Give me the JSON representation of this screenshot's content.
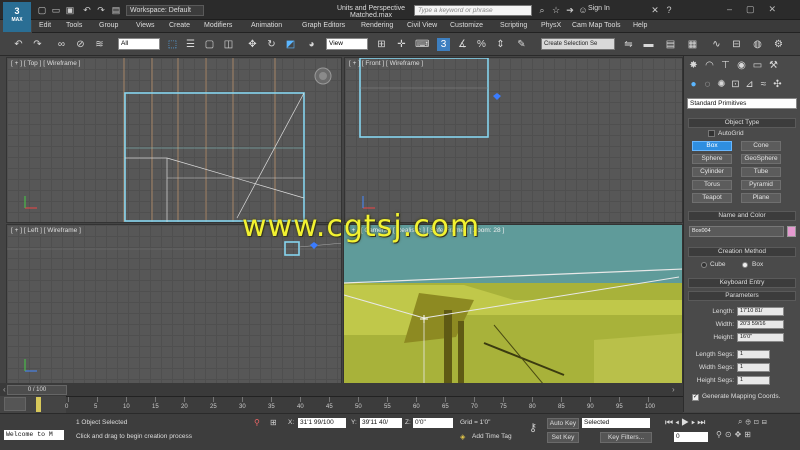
{
  "app": {
    "logo_text": "3",
    "logo_sub": "MAX",
    "workspace": "Workspace: Default",
    "document_title": "Units and Perspective Matched.max",
    "search_placeholder": "Type a keyword or phrase",
    "sign_in": "Sign In"
  },
  "menu": [
    "Edit",
    "Tools",
    "Group",
    "Views",
    "Create",
    "Modifiers",
    "Animation",
    "Graph Editors",
    "Rendering",
    "Civil View",
    "Customize",
    "Scripting",
    "PhysX",
    "Cam Map Tools",
    "Help"
  ],
  "toolbar": {
    "selection_filter": "All",
    "reference_coord": "View",
    "snap_label": "3",
    "selection_set": "Create Selection Se"
  },
  "viewports": {
    "top": "[ + ] [ Top ] [ Wireframe ]",
    "front": "[ + ] [ Front ] [ Wireframe ]",
    "left": "[ + ] [ Left ] [ Wireframe ]",
    "camera": "[ + ] [ Camera ] [ Realistic ] [ Safe Frame ] [ Zoom: 28 ]"
  },
  "watermark": "www.cgtsj.com",
  "command_panel": {
    "category": "Standard Primitives",
    "object_type_title": "Object Type",
    "autogrid": "AutoGrid",
    "buttons": [
      "Box",
      "Cone",
      "Sphere",
      "GeoSphere",
      "Cylinder",
      "Tube",
      "Torus",
      "Pyramid",
      "Teapot",
      "Plane"
    ],
    "selected_button": "Box",
    "name_color_title": "Name and Color",
    "object_name": "Box004",
    "object_color": "#e59ad0",
    "creation_method_title": "Creation Method",
    "creation_cube": "Cube",
    "creation_box": "Box",
    "keyboard_entry_title": "Keyboard Entry",
    "parameters_title": "Parameters",
    "length_label": "Length:",
    "length_value": "17'10 81/",
    "width_label": "Width:",
    "width_value": "20'3 59/16",
    "height_label": "Height:",
    "height_value": "16'0\"",
    "length_segs_label": "Length Segs:",
    "length_segs": "1",
    "width_segs_label": "Width Segs:",
    "width_segs": "1",
    "height_segs_label": "Height Segs:",
    "height_segs": "1",
    "gen_mapping": "Generate Mapping Coords."
  },
  "timeline": {
    "slider": "0 / 100",
    "ticks": [
      "0",
      "5",
      "10",
      "15",
      "20",
      "25",
      "30",
      "35",
      "40",
      "45",
      "50",
      "55",
      "60",
      "65",
      "70",
      "75",
      "80",
      "85",
      "90",
      "95",
      "100"
    ]
  },
  "status": {
    "maxscript": "Welcome to M",
    "selected": "1 Object Selected",
    "prompt": "Click and drag to begin creation process",
    "x_label": "X:",
    "x_value": "31'1 99/100",
    "y_label": "Y:",
    "y_value": "39'11 40/",
    "z_label": "Z:",
    "z_value": "0'0\"",
    "grid": "Grid = 1'0\"",
    "add_time_tag": "Add Time Tag",
    "auto_key": "Auto Key",
    "set_key": "Set Key",
    "key_mode": "Selected",
    "key_filters": "Key Filters...",
    "frame": "0"
  },
  "colors": {
    "accent": "#2f8ee0",
    "box_wire": "#86d4ee",
    "camera_bg": "#a8b23a",
    "camera_sky": "#5f9b9a",
    "watermark": "#f2f231"
  }
}
